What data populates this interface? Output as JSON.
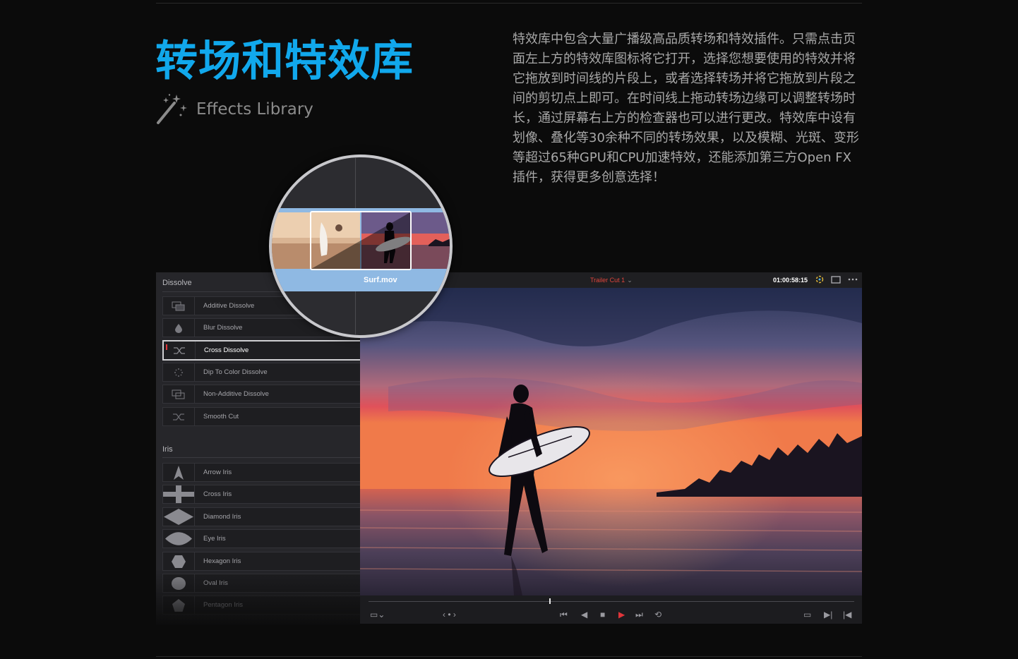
{
  "heading": {
    "title": "转场和特效库",
    "subtitle": "Effects Library",
    "icon": "magic-wand-icon"
  },
  "description": "特效库中包含大量广播级高品质转场和特效插件。只需点击页面左上方的特效库图标将它打开，选择您想要使用的特效并将它拖放到时间线的片段上，或者选择转场并将它拖放到片段之间的剪切点上即可。在时间线上拖动转场边缘可以调整转场时长，通过屏幕右上方的检查器也可以进行更改。特效库中设有划像、叠化等30余种不同的转场效果，以及模糊、光斑、变形等超过65种GPU和CPU加速特效，还能添加第三方Open FX插件，获得更多创意选择！",
  "effects_panel": {
    "sections": [
      {
        "name": "Dissolve",
        "items": [
          {
            "label": "Additive Dissolve",
            "icon": "additive-dissolve-icon"
          },
          {
            "label": "Blur Dissolve",
            "icon": "blur-drop-icon"
          },
          {
            "label": "Cross Dissolve",
            "icon": "cross-arrows-icon",
            "selected": true
          },
          {
            "label": "Dip To Color Dissolve",
            "icon": "dots-circle-icon"
          },
          {
            "label": "Non-Additive Dissolve",
            "icon": "non-additive-dissolve-icon"
          },
          {
            "label": "Smooth Cut",
            "icon": "cross-arrows-icon"
          }
        ]
      },
      {
        "name": "Iris",
        "items": [
          {
            "label": "Arrow Iris",
            "icon": "arrow-shape-icon"
          },
          {
            "label": "Cross Iris",
            "icon": "plus-shape-icon"
          },
          {
            "label": "Diamond Iris",
            "icon": "diamond-shape-icon"
          },
          {
            "label": "Eye Iris",
            "icon": "eye-shape-icon"
          },
          {
            "label": "Hexagon Iris",
            "icon": "hexagon-shape-icon"
          },
          {
            "label": "Oval Iris",
            "icon": "oval-shape-icon"
          },
          {
            "label": "Pentagon Iris",
            "icon": "pentagon-shape-icon"
          }
        ]
      }
    ]
  },
  "viewer": {
    "timeline_name": "Trailer Cut 1",
    "timecode": "01:00:58:15",
    "scrub_progress": 0.37
  },
  "timeline_zoom": {
    "clip_name": "Surf.mov"
  },
  "colors": {
    "title_blue": "#11a8ec",
    "accent_red": "#e0353a",
    "clip_blue": "#8fb9e3"
  }
}
